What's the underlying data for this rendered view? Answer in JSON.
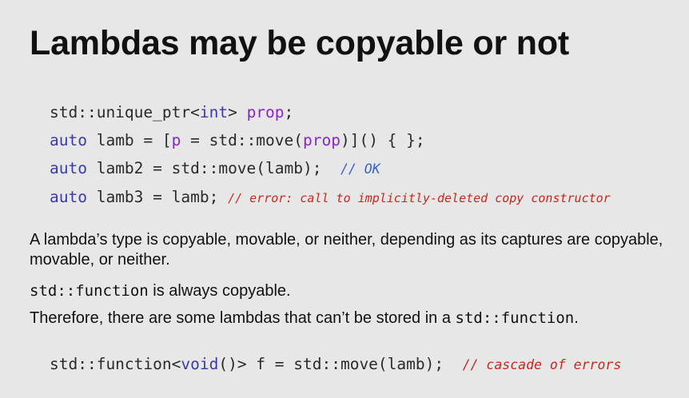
{
  "title": "Lambdas may be copyable or not",
  "code_block_1": {
    "line1": {
      "prefix": "std::unique_ptr<",
      "type": "int",
      "mid": "> ",
      "var": "prop",
      "suffix": ";"
    },
    "line2": {
      "kw": "auto",
      "a": " lamb = [",
      "p": "p",
      "b": " = std::move(",
      "prop": "prop",
      "c": ")]() { };"
    },
    "line3": {
      "kw": "auto",
      "a": " lamb2 = std::move(lamb);  ",
      "comment": "// OK"
    },
    "line4": {
      "kw": "auto",
      "a": " lamb3 = lamb; ",
      "comment": "// error: call to implicitly-deleted copy constructor"
    }
  },
  "paragraphs": {
    "p1": "A lambda’s type is copyable, movable, or neither, depending as its captures are copyable, movable, or neither.",
    "p2_code": "std::function",
    "p2_text": " is always copyable.",
    "p3_text": "Therefore, there are some lambdas that can’t be stored in a ",
    "p3_code": "std::function",
    "p3_end": "."
  },
  "code_block_2": {
    "a": "std::function<",
    "type": "void",
    "b": "()> f = std::move(lamb);  ",
    "comment": "// cascade of errors"
  },
  "colors": {
    "background": "#e7e7e7",
    "keyword": "#3a3aa8",
    "purple": "#8a25c9",
    "comment_blue": "#3a5fc9",
    "comment_red": "#c8281e"
  }
}
